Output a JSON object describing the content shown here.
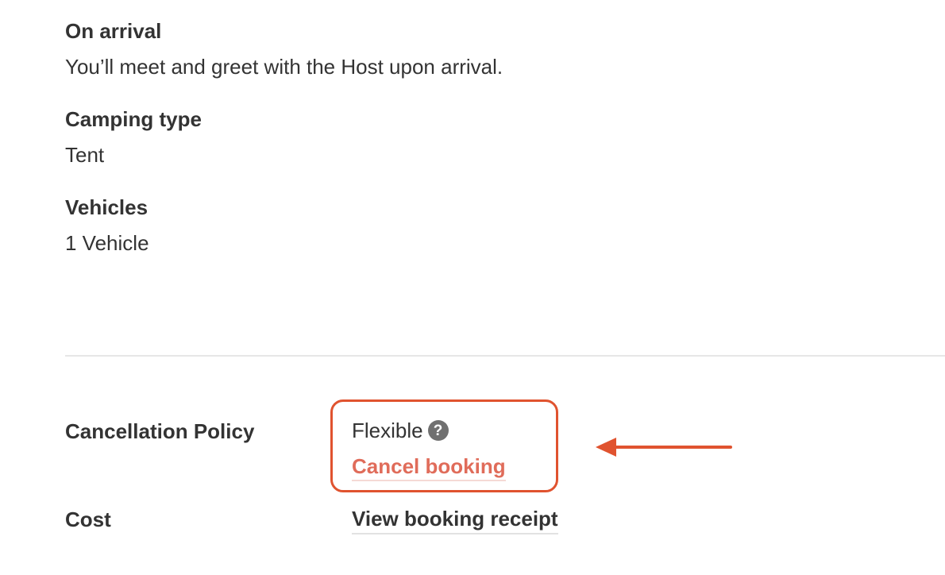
{
  "details": {
    "arrival": {
      "heading": "On arrival",
      "value": "You’ll meet and greet with the Host upon arrival."
    },
    "camping_type": {
      "heading": "Camping type",
      "value": "Tent"
    },
    "vehicles": {
      "heading": "Vehicles",
      "value": "1 Vehicle"
    }
  },
  "policy": {
    "heading": "Cancellation Policy",
    "value": "Flexible",
    "help_icon": "question-circle-icon",
    "cancel_label": "Cancel booking"
  },
  "cost": {
    "heading": "Cost",
    "receipt_label": "View booking receipt"
  },
  "colors": {
    "text": "#333333",
    "cancel_link": "#e06c5a",
    "highlight": "#e0532f",
    "divider": "#e6e6e6",
    "help_icon": "#707070"
  }
}
